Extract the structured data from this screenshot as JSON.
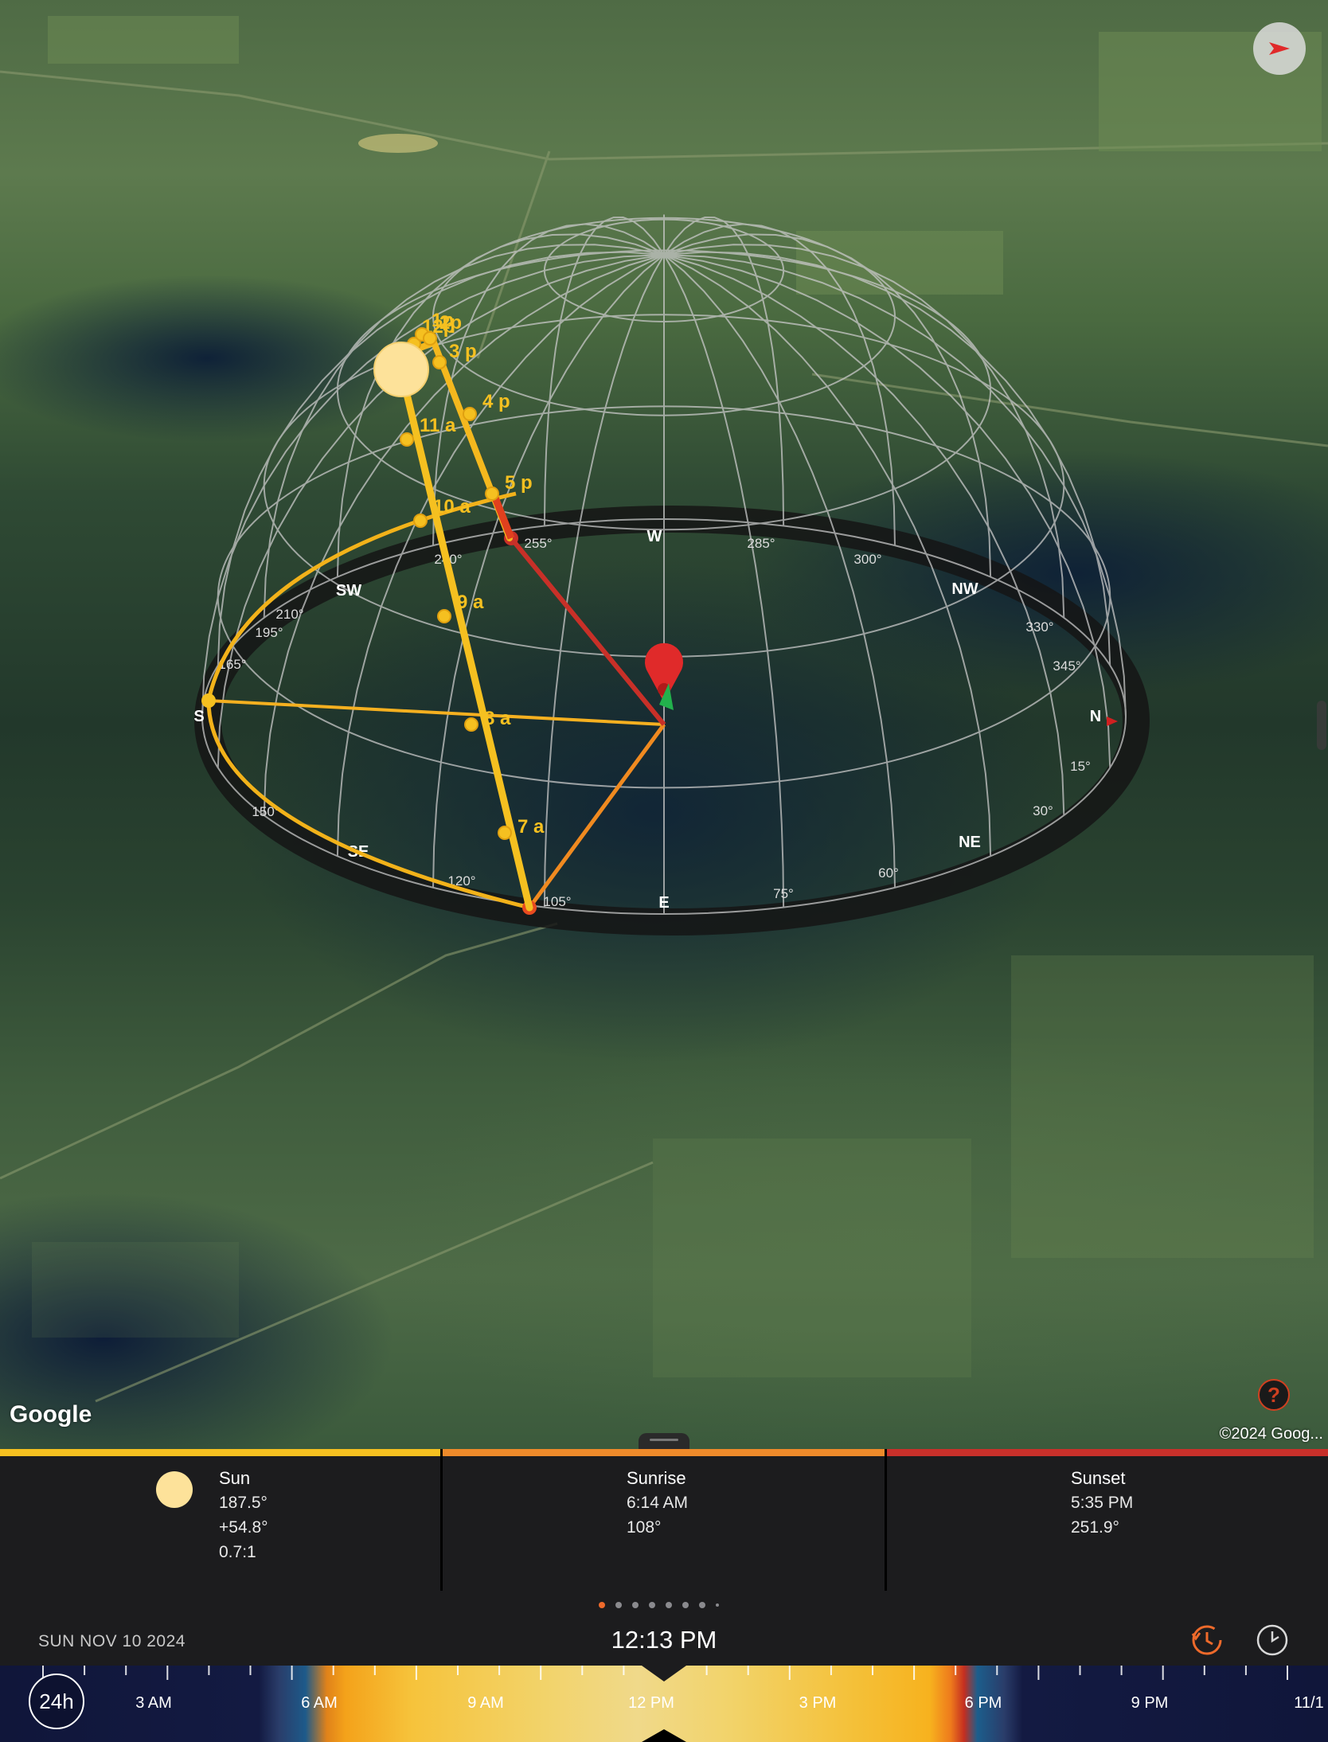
{
  "map": {
    "logo": "Google",
    "attribution": "©2024 Goog...",
    "help_label": "?",
    "compass_labels": [
      "S",
      "SW",
      "W",
      "NW",
      "N",
      "NE",
      "E",
      "SE"
    ],
    "compass_degrees": [
      "165°",
      "195°",
      "210°",
      "240°",
      "255°",
      "285°",
      "300°",
      "330°",
      "345°",
      "15°",
      "30°",
      "60°",
      "75°",
      "105°",
      "120°",
      "150°"
    ],
    "hour_labels_path": [
      "7 a",
      "8 a",
      "9 a",
      "10 a",
      "11 a",
      "12p",
      "1p",
      "2p",
      "3 p",
      "4 p",
      "5 p"
    ]
  },
  "info": {
    "sun": {
      "title": "Sun",
      "azimuth": "187.5°",
      "altitude": "+54.8°",
      "ratio": "0.7:1"
    },
    "sunrise": {
      "title": "Sunrise",
      "time": "6:14 AM",
      "azimuth": "108°"
    },
    "sunset": {
      "title": "Sunset",
      "time": "5:35 PM",
      "azimuth": "251.9°"
    }
  },
  "status": {
    "date": "SUN NOV 10 2024",
    "time": "12:13 PM"
  },
  "timeline": {
    "zoom_label": "24h",
    "ticks": [
      "3 AM",
      "6 AM",
      "9 AM",
      "12 PM",
      "3 PM",
      "6 PM",
      "9 PM",
      "11/1"
    ]
  },
  "colors": {
    "sun": "#fde29a",
    "sun_bar": "#f5c020",
    "sunrise_bar": "#ee8a2a",
    "sunset_bar": "#c8302a",
    "accent": "#ee6a2b"
  }
}
